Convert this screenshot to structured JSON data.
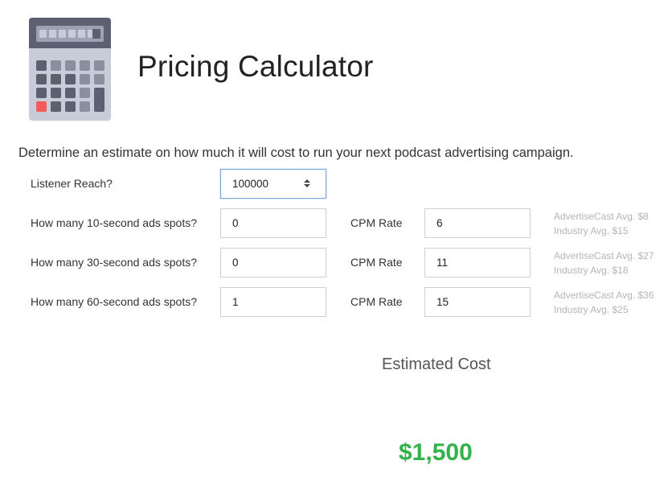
{
  "page": {
    "title": "Pricing Calculator",
    "description": "Determine an estimate on how much it will cost to run your next podcast advertising campaign."
  },
  "icon": {
    "name": "calculator-icon"
  },
  "form": {
    "listener_reach": {
      "label": "Listener Reach?",
      "value": "100000"
    },
    "rows": [
      {
        "label": "How many 10-second ads spots?",
        "spots": "0",
        "cpm_label": "CPM Rate",
        "cpm": "6",
        "advertisecast_avg": "AdvertiseCast Avg. $8",
        "industry_avg": "Industry Avg. $15"
      },
      {
        "label": "How many 30-second ads spots?",
        "spots": "0",
        "cpm_label": "CPM Rate",
        "cpm": "11",
        "advertisecast_avg": "AdvertiseCast Avg. $27",
        "industry_avg": "Industry Avg. $18"
      },
      {
        "label": "How many 60-second ads spots?",
        "spots": "1",
        "cpm_label": "CPM Rate",
        "cpm": "15",
        "advertisecast_avg": "AdvertiseCast Avg. $36",
        "industry_avg": "Industry Avg. $25"
      }
    ]
  },
  "result": {
    "label": "Estimated Cost",
    "value": "$1,500"
  },
  "colors": {
    "result_green": "#33b249",
    "hint_gray": "#b5b5b5",
    "focus_border": "#7aa7d8",
    "calc_key_red": "#f45b5b"
  }
}
